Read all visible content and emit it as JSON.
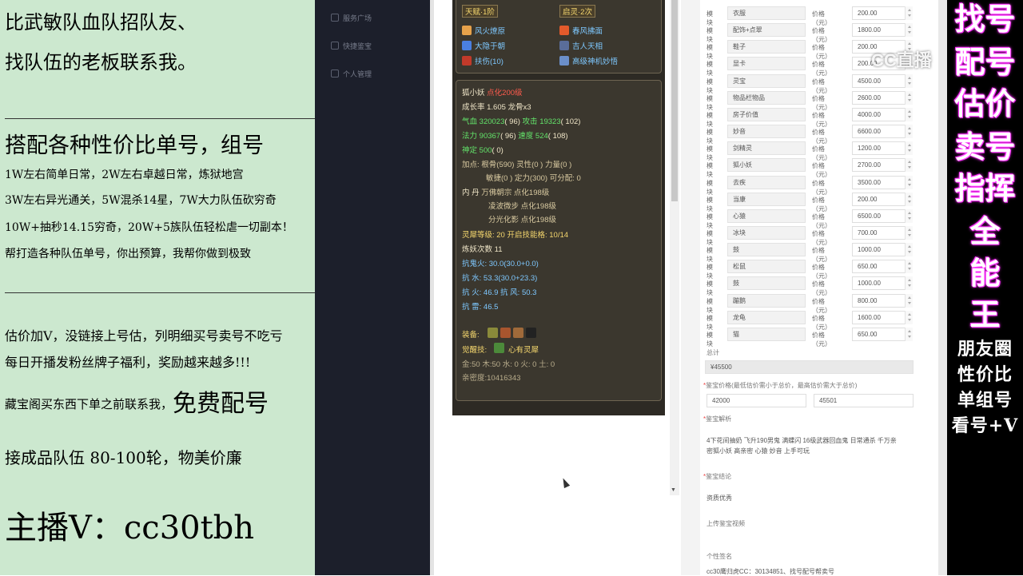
{
  "left_panel": {
    "line1": "比武敏队血队招队友、",
    "line2": "找队伍的老板联系我。",
    "heading2": "搭配各种性价比单号，组号",
    "list": [
      "1W左右简单日常，2W左右卓越日常，炼狱地宫",
      "3W左右异光通关，5W混杀14星，7W大力队伍砍穷奇",
      "10W+抽秒14.15穷奇，20W+5族队伍轻松虐一切副本！",
      "帮打造各种队伍单号，你出预算，我帮你做到极致"
    ],
    "p1": "估价加V，没链接上号估，列明细买号卖号不吃亏",
    "p2": "每日开播发粉丝牌子福利，奖励越来越多!!!",
    "p3a": "藏宝阁买东西下单之前联系我，",
    "p3b": "免费配号",
    "p4": "接成品队伍 80-100轮，物美价廉",
    "streamer": "主播V：cc30tbh"
  },
  "nav": {
    "items": [
      "服务广场",
      "快捷鉴宝",
      "个人管理"
    ]
  },
  "game": {
    "tianfu": "天赋·1阶",
    "qiling": "启灵·2次",
    "skills": [
      {
        "name": "风火燎原",
        "color": "#e7a24a"
      },
      {
        "name": "春风拂面",
        "color": "#e35a2b"
      },
      {
        "name": "大隐于朝",
        "color": "#4a7fe0"
      },
      {
        "name": "吉人天相",
        "color": "#5a6d9a"
      },
      {
        "name": "扶伤(10)",
        "color": "#c23a2a"
      },
      {
        "name": "高级神机妙悟",
        "color": "#6b8fc9"
      }
    ],
    "pet_name": "狐小妖",
    "pet_tag": "点化200级",
    "growth": "成长率 1.605 龙骨x3",
    "hp_label": "气血",
    "hp": "320023",
    "hp_add": "( 96)",
    "atk_label": "攻击",
    "atk": "19323",
    "atk_add": "( 102)",
    "mp_label": "法力",
    "mp": "90367",
    "mp_add": "( 96)",
    "spd_label": "速度",
    "spd": "524",
    "spd_add": "( 108)",
    "shen_label": "神定",
    "shen": "500",
    "shen_add": "( 0)",
    "pts1": "加点: 根骨(590) 灵性(0 ) 力量(0 )",
    "pts2": "敏捷(0 ) 定力(300) 可分配: 0",
    "neidan_label": "内  丹",
    "neidan1": "万佛朝宗 点化198级",
    "neidan2": "凌波微步 点化198级",
    "neidan3": "分光化影 点化198级",
    "linxi": "灵犀等级: 20 开启技能格: 10/14",
    "lianyao": "炼妖次数 11",
    "res1": "抗鬼火: 30.0(30.0+0.0)",
    "res2": "抗   水: 53.3(30.0+23.3)",
    "res3": "抗   火: 46.9 抗   风: 50.3",
    "res4": "抗   雷: 46.5",
    "equip_label": "装备:",
    "awake_label": "觉醒技:",
    "awake": "心有灵犀",
    "elements": "金:50 木:50 水: 0 火: 0 土: 0",
    "intimacy": "亲密度:10416343"
  },
  "form": {
    "module_label": "模块",
    "price_label": "价格（元）",
    "rows": [
      {
        "name": "衣服",
        "price": "200.00"
      },
      {
        "name": "配饰+点翠",
        "price": "1800.00"
      },
      {
        "name": "鞋子",
        "price": "200.00"
      },
      {
        "name": "显卡",
        "price": "200.00"
      },
      {
        "name": "灵宝",
        "price": "4500.00"
      },
      {
        "name": "物品栏物品",
        "price": "2600.00"
      },
      {
        "name": "房子价值",
        "price": "4000.00"
      },
      {
        "name": "妙音",
        "price": "6600.00"
      },
      {
        "name": "剑精灵",
        "price": "1200.00"
      },
      {
        "name": "狐小妖",
        "price": "2700.00"
      },
      {
        "name": "去疾",
        "price": "3500.00"
      },
      {
        "name": "当康",
        "price": "200.00"
      },
      {
        "name": "心猿",
        "price": "6500.00"
      },
      {
        "name": "冰块",
        "price": "700.00"
      },
      {
        "name": "鼓",
        "price": "1000.00"
      },
      {
        "name": "松鼠",
        "price": "650.00"
      },
      {
        "name": "鼓",
        "price": "1000.00"
      },
      {
        "name": "蹦鹅",
        "price": "800.00"
      },
      {
        "name": "龙龟",
        "price": "1600.00"
      },
      {
        "name": "猫",
        "price": "650.00"
      }
    ],
    "total_label": "总计",
    "total": "¥45500",
    "range_label": "鉴宝价格(最低估价需小于总价，最高估价需大于总价)",
    "min": "42000",
    "max": "45501",
    "analysis_label": "鉴宝解析",
    "analysis_line1": "4下花间抽奶 飞升190男鬼 满蝶闪 16级武器回血鬼 日常通杀 千万亲",
    "analysis_line2": "密狐小妖 高亲密 心猿 妙音 上手可玩",
    "conclusion_label": "鉴宝结论",
    "conclusion": "资质优秀",
    "video_label": "上传鉴宝视频",
    "sign_label": "个性签名",
    "sign": "cc30鹰归虎CC：30134851、找号配号帮卖号"
  },
  "right_panel": {
    "vertical": [
      "找号",
      "配号",
      "估价",
      "卖号",
      "指挥",
      "全",
      "能",
      "王"
    ],
    "small": [
      "朋友圈",
      "性价比",
      "单组号",
      "看号+V"
    ]
  },
  "watermark": "CC直播"
}
